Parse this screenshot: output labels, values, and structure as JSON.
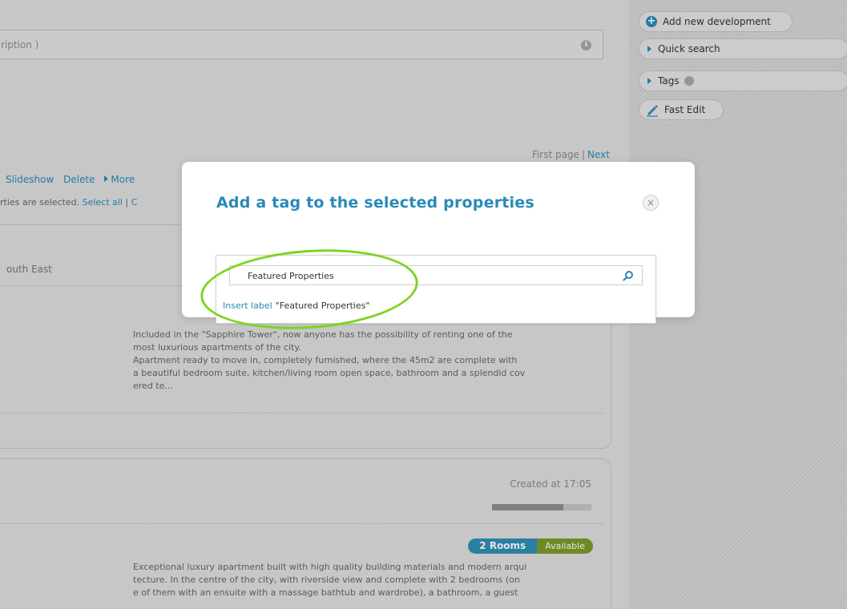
{
  "main": {
    "search_placeholder": "ription )",
    "info_glyph": "i",
    "pager": {
      "first": "First page",
      "sep": "|",
      "next": "Next"
    },
    "actions": {
      "slideshow": "Slideshow",
      "delete": "Delete",
      "more": "More"
    },
    "selection": {
      "text": "rties are selected.",
      "select_all": "Select all",
      "sep": "|",
      "trailing": "C"
    },
    "card1": {
      "location": "outh East",
      "description": [
        "Included in the \"Sapphire Tower\", now anyone has the possibility of renting one of the",
        "most luxurious apartments of the city.",
        "Apartment ready to move in, completely furnished, where the 45m2 are complete with",
        "a beautiful bedroom suite, kitchen/living room open space, bathroom and a splendid cov",
        "ered te..."
      ]
    },
    "card2": {
      "created": "Created at 17:05",
      "progress": 0.72,
      "rooms_badge": "2 Rooms",
      "availability_badge": "Available",
      "description": [
        "Exceptional luxury apartment built with high quality building materials and modern arqui",
        "tecture. In the centre of the city, with riverside view and complete with 2 bedrooms (on",
        "e of them with an ensuite with a massage bathtub and wardrobe), a bathroom, a guest"
      ]
    }
  },
  "sidebar": {
    "add_development": "Add new development",
    "quick_search": "Quick search",
    "tags": "Tags",
    "fast_edit": "Fast Edit"
  },
  "modal": {
    "title": "Add a tag to the selected properties",
    "close_glyph": "×",
    "input_value": "Featured Properties",
    "insert_label": "Insert label",
    "insert_value": "\"Featured Properties\""
  },
  "colors": {
    "accent": "#2a8ab8",
    "highlight": "#7ed321",
    "available": "#7c9a2a"
  }
}
